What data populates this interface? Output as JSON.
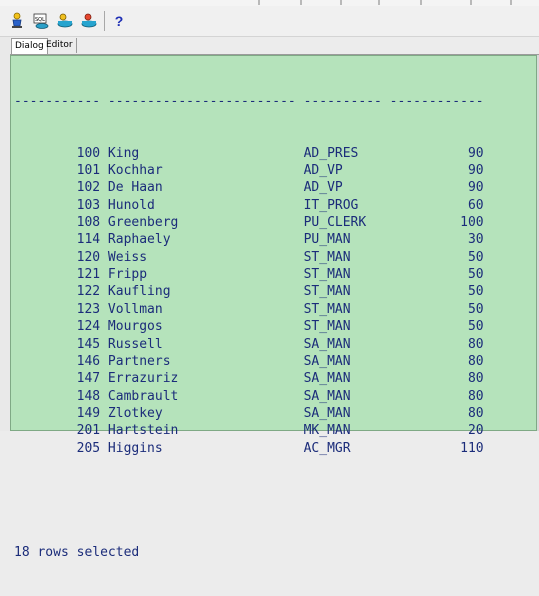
{
  "toolbar": {
    "buttons": [
      {
        "icon": "person-run-icon"
      },
      {
        "icon": "sql-file-icon"
      },
      {
        "icon": "database-connect-icon"
      },
      {
        "icon": "database-disconnect-icon"
      },
      {
        "icon": "help-icon",
        "glyph": "?"
      }
    ]
  },
  "tabs": [
    {
      "label": "Dialog",
      "active": true
    },
    {
      "label": "Editor",
      "active": false
    }
  ],
  "output": {
    "separator": "----------- ------------------------ ---------- ------------",
    "rows": [
      {
        "id": "100",
        "name": "King",
        "job": "AD_PRES",
        "dept": "90"
      },
      {
        "id": "101",
        "name": "Kochhar",
        "job": "AD_VP",
        "dept": "90"
      },
      {
        "id": "102",
        "name": "De Haan",
        "job": "AD_VP",
        "dept": "90"
      },
      {
        "id": "103",
        "name": "Hunold",
        "job": "IT_PROG",
        "dept": "60"
      },
      {
        "id": "108",
        "name": "Greenberg",
        "job": "PU_CLERK",
        "dept": "100"
      },
      {
        "id": "114",
        "name": "Raphaely",
        "job": "PU_MAN",
        "dept": "30"
      },
      {
        "id": "120",
        "name": "Weiss",
        "job": "ST_MAN",
        "dept": "50"
      },
      {
        "id": "121",
        "name": "Fripp",
        "job": "ST_MAN",
        "dept": "50"
      },
      {
        "id": "122",
        "name": "Kaufling",
        "job": "ST_MAN",
        "dept": "50"
      },
      {
        "id": "123",
        "name": "Vollman",
        "job": "ST_MAN",
        "dept": "50"
      },
      {
        "id": "124",
        "name": "Mourgos",
        "job": "ST_MAN",
        "dept": "50"
      },
      {
        "id": "145",
        "name": "Russell",
        "job": "SA_MAN",
        "dept": "80"
      },
      {
        "id": "146",
        "name": "Partners",
        "job": "SA_MAN",
        "dept": "80"
      },
      {
        "id": "147",
        "name": "Errazuriz",
        "job": "SA_MAN",
        "dept": "80"
      },
      {
        "id": "148",
        "name": "Cambrault",
        "job": "SA_MAN",
        "dept": "80"
      },
      {
        "id": "149",
        "name": "Zlotkey",
        "job": "SA_MAN",
        "dept": "80"
      },
      {
        "id": "201",
        "name": "Hartstein",
        "job": "MK_MAN",
        "dept": "20"
      },
      {
        "id": "205",
        "name": "Higgins",
        "job": "AC_MGR",
        "dept": "110"
      }
    ],
    "status": "18 rows selected"
  },
  "colors": {
    "output_background": "#b5e3bb",
    "output_text": "#1b2c7a"
  }
}
